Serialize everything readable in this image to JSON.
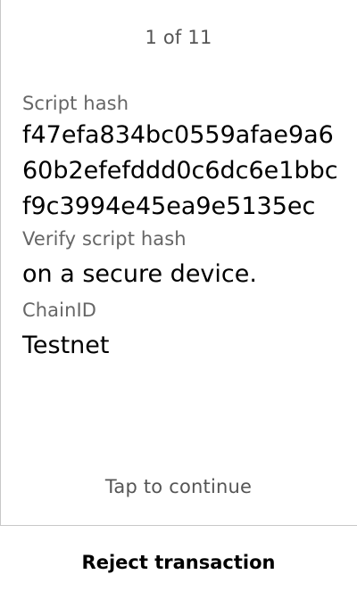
{
  "pager": {
    "text": "1 of 11"
  },
  "fields": {
    "script_hash": {
      "label": "Script hash",
      "value": "f47efa834bc0559afae9a660b2efefddd0c6dc6e1bbcf9c3994e45ea9e5135ec"
    },
    "verify": {
      "label": "Verify script hash",
      "value": "on a secure device."
    },
    "chain": {
      "label": "ChainID",
      "value": "Testnet"
    }
  },
  "tap_continue": "Tap to continue",
  "footer": {
    "reject_label": "Reject transaction"
  },
  "colors": {
    "background": "#ffffff",
    "text": "#000000",
    "muted": "#555555",
    "divider": "#c8c8c8"
  }
}
